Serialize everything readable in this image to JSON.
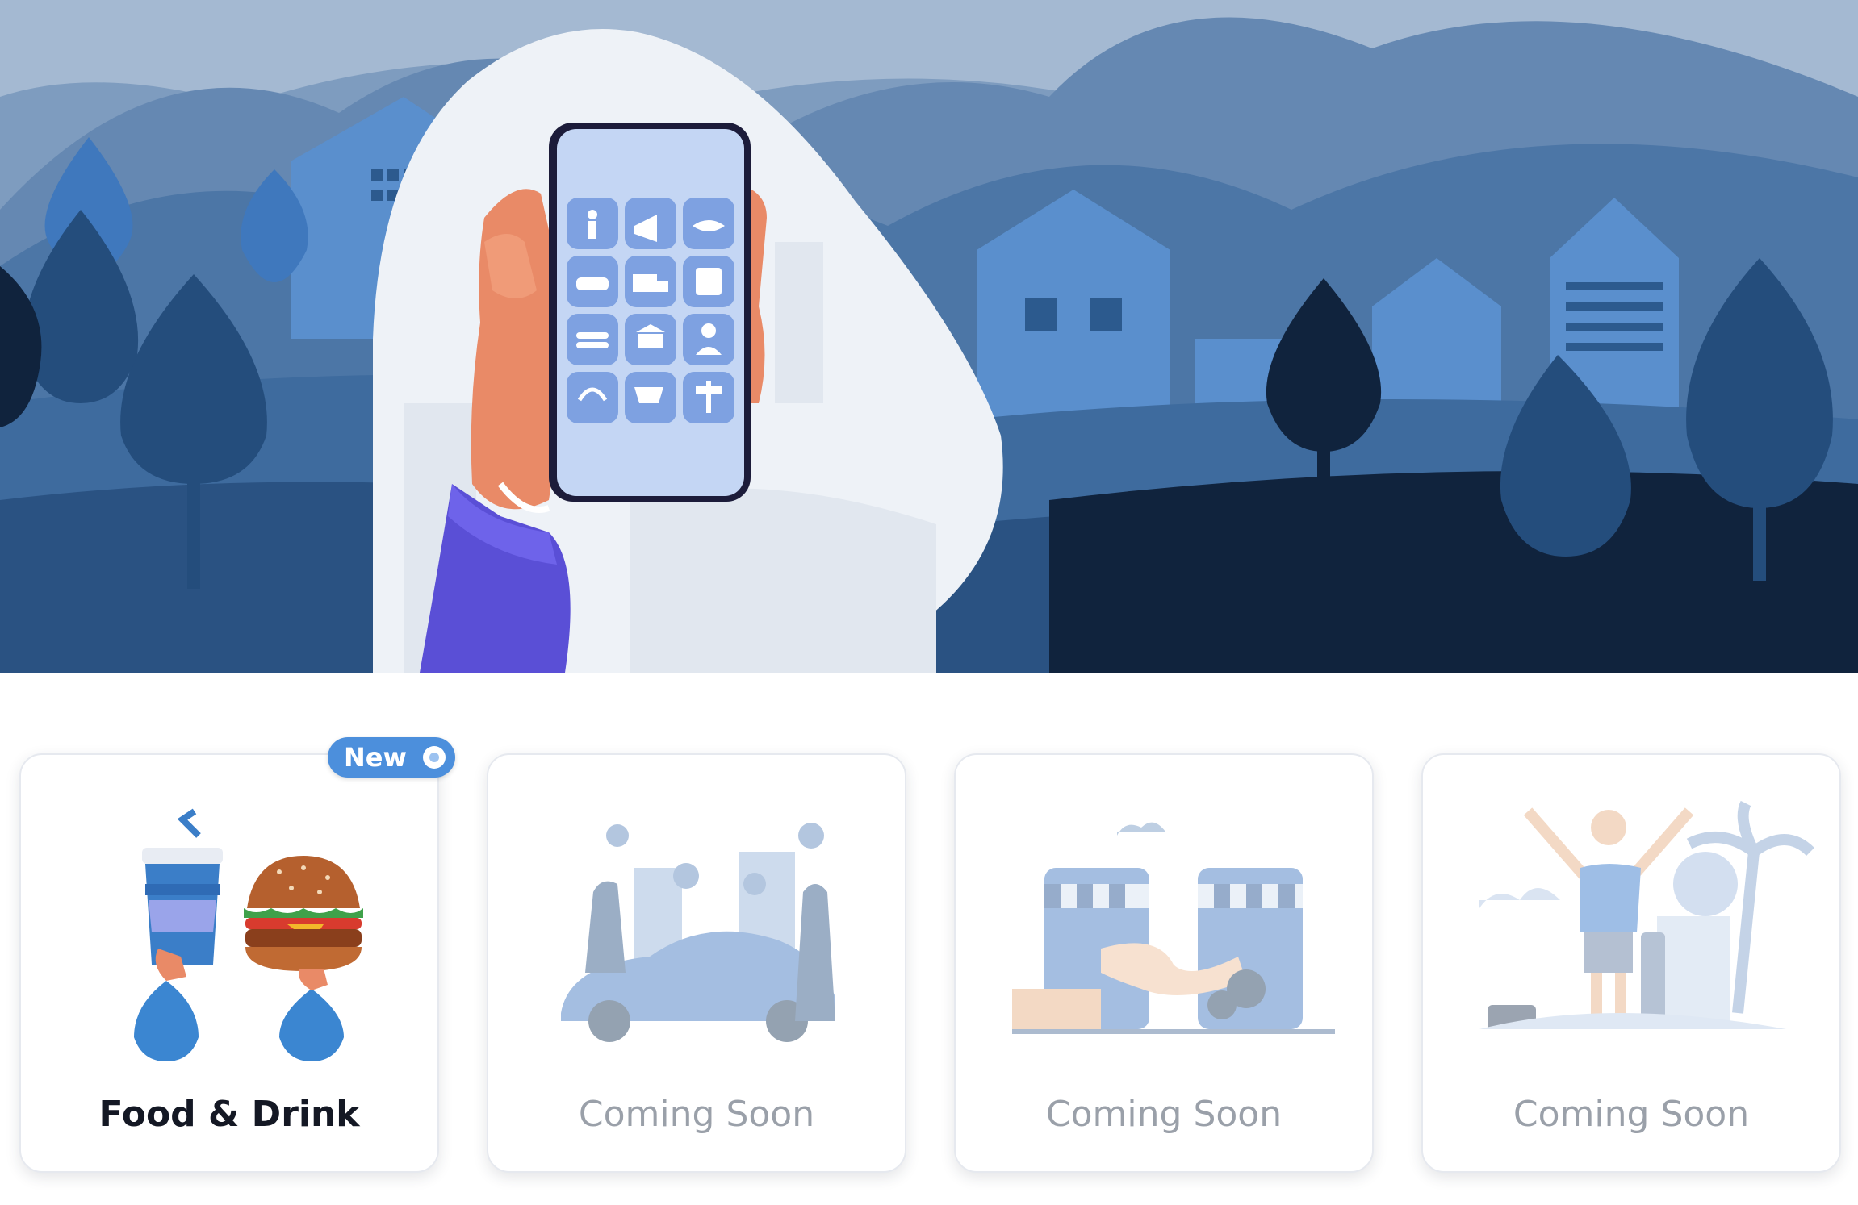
{
  "hero": {
    "illustration": "hand-holding-phone-with-service-icons",
    "app_icons": [
      "hiking-icon",
      "megaphone-icon",
      "handshake-icon",
      "carpool-icon",
      "delivery-truck-icon",
      "calendar-star-icon",
      "food-icon",
      "bank-icon",
      "person-icon",
      "headset-icon",
      "cart-icon",
      "signpost-icon"
    ]
  },
  "categories": [
    {
      "label": "Food & Drink",
      "status": "active",
      "badge": "New",
      "art": "food-drink-illustration"
    },
    {
      "label": "Coming Soon",
      "status": "soon",
      "art": "ride-sharing-illustration"
    },
    {
      "label": "Coming Soon",
      "status": "soon",
      "art": "marketplace-illustration"
    },
    {
      "label": "Coming Soon",
      "status": "soon",
      "art": "travel-illustration"
    }
  ],
  "colors": {
    "accent": "#4c8fdc",
    "sky": "#6f93b8",
    "dark": "#10233d"
  }
}
